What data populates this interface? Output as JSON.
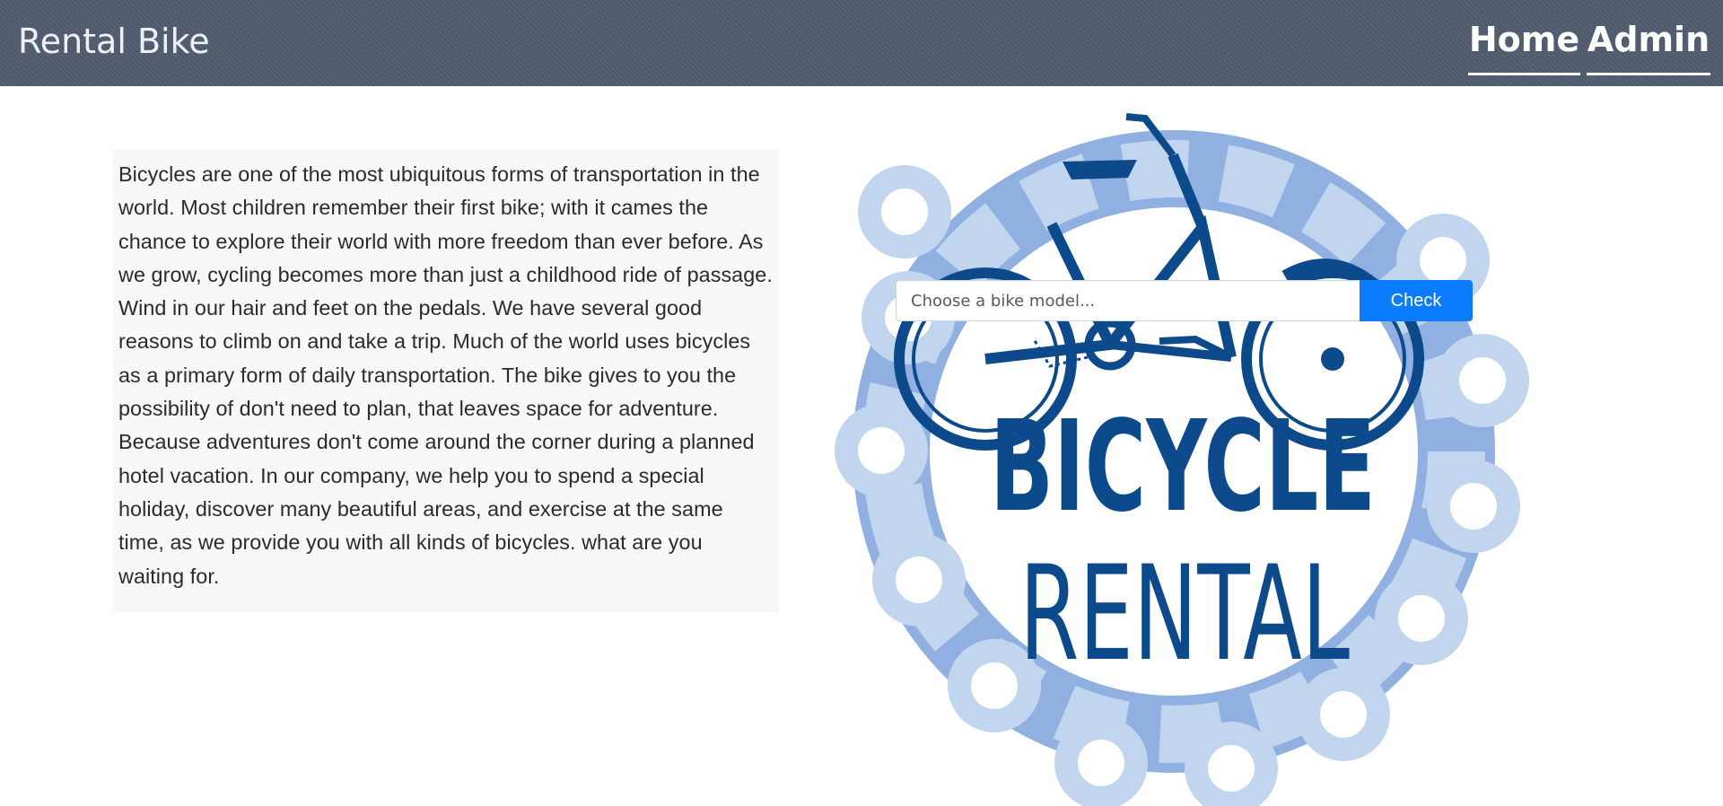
{
  "navbar": {
    "brand": "Rental Bike",
    "links": [
      {
        "label": "Home"
      },
      {
        "label": "Admin"
      }
    ]
  },
  "about": {
    "text": "Bicycles are one of the most ubiquitous forms of transportation in the world. Most children remember their first bike; with it cames the chance to explore their world with more freedom than ever before. As we grow, cycling becomes more than just a childhood ride of passage. Wind in our hair and feet on the pedals. We have several good reasons to climb on and take a trip. Much of the world uses bicycles as a primary form of daily transportation. The bike gives to you the possibility of don't need to plan, that leaves space for adventure. Because adventures don't come around the corner during a planned hotel vacation. In our company, we help you to spend a special holiday, discover many beautiful areas, and exercise at the same time, as we provide you with all kinds of bicycles. what are you waiting for."
  },
  "search": {
    "placeholder": "Choose a bike model...",
    "button_label": "Check"
  },
  "logo": {
    "line1": "BICYCLE",
    "line2": "RENTAL",
    "colors": {
      "primary": "#0c4a8c",
      "chain": "#c2d5ef",
      "chain_dark": "#7c9fd8"
    }
  },
  "colors": {
    "navbar_bg": "#525c6f",
    "button_primary": "#0b7bff"
  }
}
